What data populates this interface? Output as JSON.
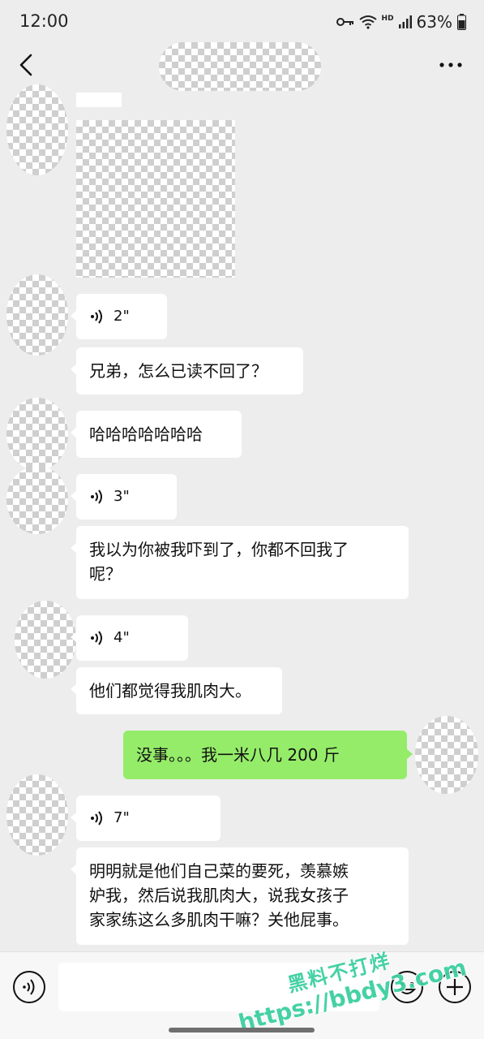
{
  "status_bar": {
    "time": "12:00",
    "hd_label": "HD",
    "battery": "63%",
    "icons": [
      "key-icon",
      "wifi-icon",
      "cell-signal-icon",
      "battery-icon"
    ]
  },
  "header": {
    "title": "",
    "back_icon": "chevron-left-icon",
    "more_icon": "more-icon"
  },
  "messages": [
    {
      "type": "image",
      "side": "left"
    },
    {
      "type": "voice",
      "side": "left",
      "duration": "2\""
    },
    {
      "type": "text",
      "side": "left",
      "text": "兄弟，怎么已读不回了？"
    },
    {
      "type": "text",
      "side": "left",
      "text": "哈哈哈哈哈哈哈"
    },
    {
      "type": "voice",
      "side": "left",
      "duration": "3\""
    },
    {
      "type": "text",
      "side": "left",
      "lines": [
        "我以为你被我吓到了，你都不回我了",
        "呢？"
      ]
    },
    {
      "type": "voice",
      "side": "left",
      "duration": "4\""
    },
    {
      "type": "text",
      "side": "left",
      "text": "他们都觉得我肌肉大。"
    },
    {
      "type": "text",
      "side": "right",
      "text": "没事。。。我一米八几 200 斤"
    },
    {
      "type": "voice",
      "side": "left",
      "duration": "7\""
    },
    {
      "type": "text",
      "side": "left",
      "lines": [
        "明明就是他们自己菜的要死，羡慕嫉",
        "妒我，然后说我肌肉大，说我女孩子",
        "家家练这么多肌肉干嘛？关他屁事。"
      ]
    }
  ],
  "input_bar": {
    "placeholder": "",
    "icons": [
      "voice-input-icon",
      "emoji-icon",
      "plus-icon"
    ]
  },
  "watermark": {
    "line1": "黑料不打烊",
    "line2": "https://bbdy3.com"
  },
  "colors": {
    "background": "#ededed",
    "bubble_left": "#ffffff",
    "bubble_right": "#95ec69",
    "watermark": "#3ccfa0"
  }
}
